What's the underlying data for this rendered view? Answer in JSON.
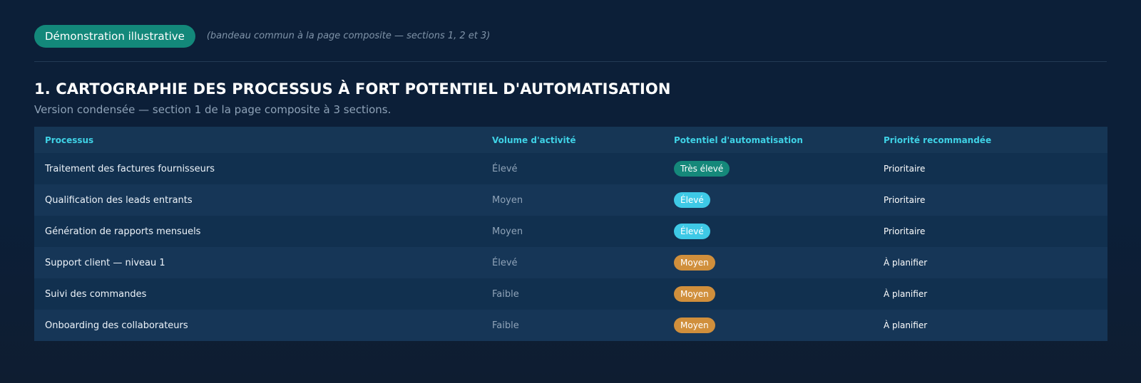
{
  "banner": {
    "label": "Démonstration illustrative",
    "note": "(bandeau commun à la page composite — sections 1, 2 et 3)"
  },
  "section": {
    "title": "1. CARTOGRAPHIE DES PROCESSUS À FORT POTENTIEL D'AUTOMATISATION",
    "subtitle": "Version condensée — section 1 de la page composite à 3 sections."
  },
  "table": {
    "headers": [
      "Processus",
      "Volume d'activité",
      "Potentiel d'automatisation",
      "Priorité recommandée"
    ],
    "rows": [
      {
        "process": "Traitement des factures fournisseurs",
        "volume": "Élevé",
        "potential": "Très élevé",
        "potential_level": "tres-eleve",
        "priority": "Prioritaire"
      },
      {
        "process": "Qualification des leads entrants",
        "volume": "Moyen",
        "potential": "Élevé",
        "potential_level": "eleve",
        "priority": "Prioritaire"
      },
      {
        "process": "Génération de rapports mensuels",
        "volume": "Moyen",
        "potential": "Élevé",
        "potential_level": "eleve",
        "priority": "Prioritaire"
      },
      {
        "process": "Support client — niveau 1",
        "volume": "Élevé",
        "potential": "Moyen",
        "potential_level": "moyen",
        "priority": "À planifier"
      },
      {
        "process": "Suivi des commandes",
        "volume": "Faible",
        "potential": "Moyen",
        "potential_level": "moyen",
        "priority": "À planifier"
      },
      {
        "process": "Onboarding des collaborateurs",
        "volume": "Faible",
        "potential": "Moyen",
        "potential_level": "moyen",
        "priority": "À planifier"
      }
    ]
  },
  "colors": {
    "background": "#0c1f38",
    "accent_teal": "#13887a",
    "accent_cyan": "#3fd2e6",
    "badge_high": "#3ec9e6",
    "badge_medium": "#d08f3c"
  }
}
